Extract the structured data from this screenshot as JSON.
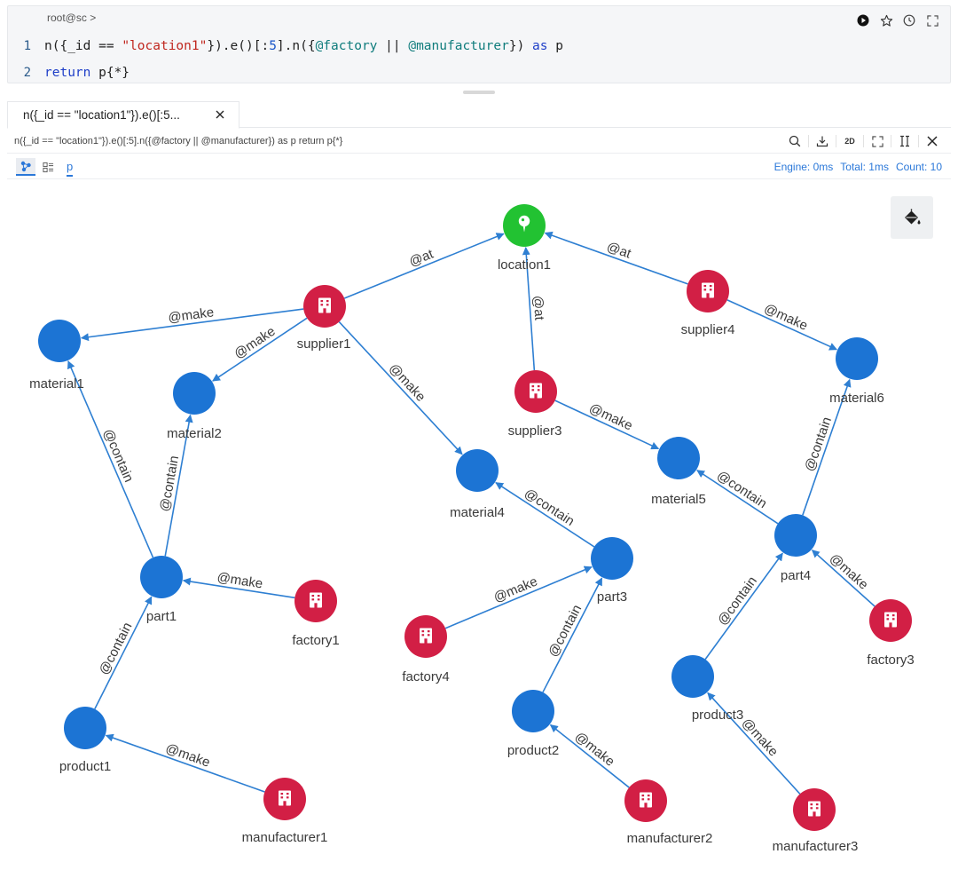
{
  "editor": {
    "prompt": "root@sc >",
    "lines": [
      {
        "num": "1",
        "tokens": [
          {
            "t": "n({_id == ",
            "c": "plain"
          },
          {
            "t": "\"location1\"",
            "c": "str"
          },
          {
            "t": "}).e()[:",
            "c": "plain"
          },
          {
            "t": "5",
            "c": "num"
          },
          {
            "t": "].n({",
            "c": "plain"
          },
          {
            "t": "@factory",
            "c": "prop"
          },
          {
            "t": " || ",
            "c": "plain"
          },
          {
            "t": "@manufacturer",
            "c": "prop"
          },
          {
            "t": "}) ",
            "c": "plain"
          },
          {
            "t": "as",
            "c": "kw"
          },
          {
            "t": " p",
            "c": "plain"
          }
        ]
      },
      {
        "num": "2",
        "tokens": [
          {
            "t": "return",
            "c": "kw"
          },
          {
            "t": " p{*}",
            "c": "plain"
          }
        ]
      }
    ],
    "tools": [
      "run-icon",
      "star-icon",
      "history-icon",
      "fullscreen-icon"
    ]
  },
  "result": {
    "tab_label": "n({_id == \"location1\"}).e()[:5...",
    "query_text": "n({_id == \"location1\"}).e()[:5].n({@factory || @manufacturer}) as p return p{*}",
    "tools": [
      "search-icon",
      "download-icon",
      "2d-toggle",
      "fullscreen-icon",
      "split-icon",
      "close-icon"
    ],
    "mode_2d_label": "2D",
    "alias": "p",
    "stats": {
      "engine": "Engine: 0ms",
      "total": "Total: 1ms",
      "count": "Count: 10"
    }
  },
  "graph": {
    "colors": {
      "location": "#22c232",
      "building": "#d21f45",
      "blue": "#1c74d4",
      "edge": "#2e7fd2"
    },
    "nodes": [
      {
        "id": "location1",
        "label": "location1",
        "type": "location"
      },
      {
        "id": "supplier1",
        "label": "supplier1",
        "type": "building"
      },
      {
        "id": "supplier3",
        "label": "supplier3",
        "type": "building"
      },
      {
        "id": "supplier4",
        "label": "supplier4",
        "type": "building"
      },
      {
        "id": "material1",
        "label": "material1",
        "type": "blue"
      },
      {
        "id": "material2",
        "label": "material2",
        "type": "blue"
      },
      {
        "id": "material4",
        "label": "material4",
        "type": "blue"
      },
      {
        "id": "material5",
        "label": "material5",
        "type": "blue"
      },
      {
        "id": "material6",
        "label": "material6",
        "type": "blue"
      },
      {
        "id": "part1",
        "label": "part1",
        "type": "blue"
      },
      {
        "id": "part3",
        "label": "part3",
        "type": "blue"
      },
      {
        "id": "part4",
        "label": "part4",
        "type": "blue"
      },
      {
        "id": "factory1",
        "label": "factory1",
        "type": "building"
      },
      {
        "id": "factory3",
        "label": "factory3",
        "type": "building"
      },
      {
        "id": "factory4",
        "label": "factory4",
        "type": "building"
      },
      {
        "id": "product1",
        "label": "product1",
        "type": "blue"
      },
      {
        "id": "product2",
        "label": "product2",
        "type": "blue"
      },
      {
        "id": "product3",
        "label": "product3",
        "type": "blue"
      },
      {
        "id": "manufacturer1",
        "label": "manufacturer1",
        "type": "building"
      },
      {
        "id": "manufacturer2",
        "label": "manufacturer2",
        "type": "building"
      },
      {
        "id": "manufacturer3",
        "label": "manufacturer3",
        "type": "building"
      }
    ],
    "edges": [
      {
        "from": "supplier1",
        "to": "location1",
        "label": "@at"
      },
      {
        "from": "supplier3",
        "to": "location1",
        "label": "@at"
      },
      {
        "from": "supplier4",
        "to": "location1",
        "label": "@at"
      },
      {
        "from": "supplier1",
        "to": "material1",
        "label": "@make"
      },
      {
        "from": "supplier1",
        "to": "material2",
        "label": "@make"
      },
      {
        "from": "supplier1",
        "to": "material4",
        "label": "@make"
      },
      {
        "from": "supplier3",
        "to": "material5",
        "label": "@make"
      },
      {
        "from": "supplier4",
        "to": "material6",
        "label": "@make"
      },
      {
        "from": "part1",
        "to": "material1",
        "label": "@contain"
      },
      {
        "from": "part1",
        "to": "material2",
        "label": "@contain"
      },
      {
        "from": "part3",
        "to": "material4",
        "label": "@contain"
      },
      {
        "from": "part4",
        "to": "material5",
        "label": "@contain"
      },
      {
        "from": "part4",
        "to": "material6",
        "label": "@contain"
      },
      {
        "from": "factory1",
        "to": "part1",
        "label": "@make"
      },
      {
        "from": "factory4",
        "to": "part3",
        "label": "@make"
      },
      {
        "from": "factory3",
        "to": "part4",
        "label": "@make"
      },
      {
        "from": "product1",
        "to": "part1",
        "label": "@contain"
      },
      {
        "from": "product2",
        "to": "part3",
        "label": "@contain"
      },
      {
        "from": "product3",
        "to": "part4",
        "label": "@contain"
      },
      {
        "from": "manufacturer1",
        "to": "product1",
        "label": "@make"
      },
      {
        "from": "manufacturer2",
        "to": "product2",
        "label": "@make"
      },
      {
        "from": "manufacturer3",
        "to": "product3",
        "label": "@make"
      }
    ]
  }
}
